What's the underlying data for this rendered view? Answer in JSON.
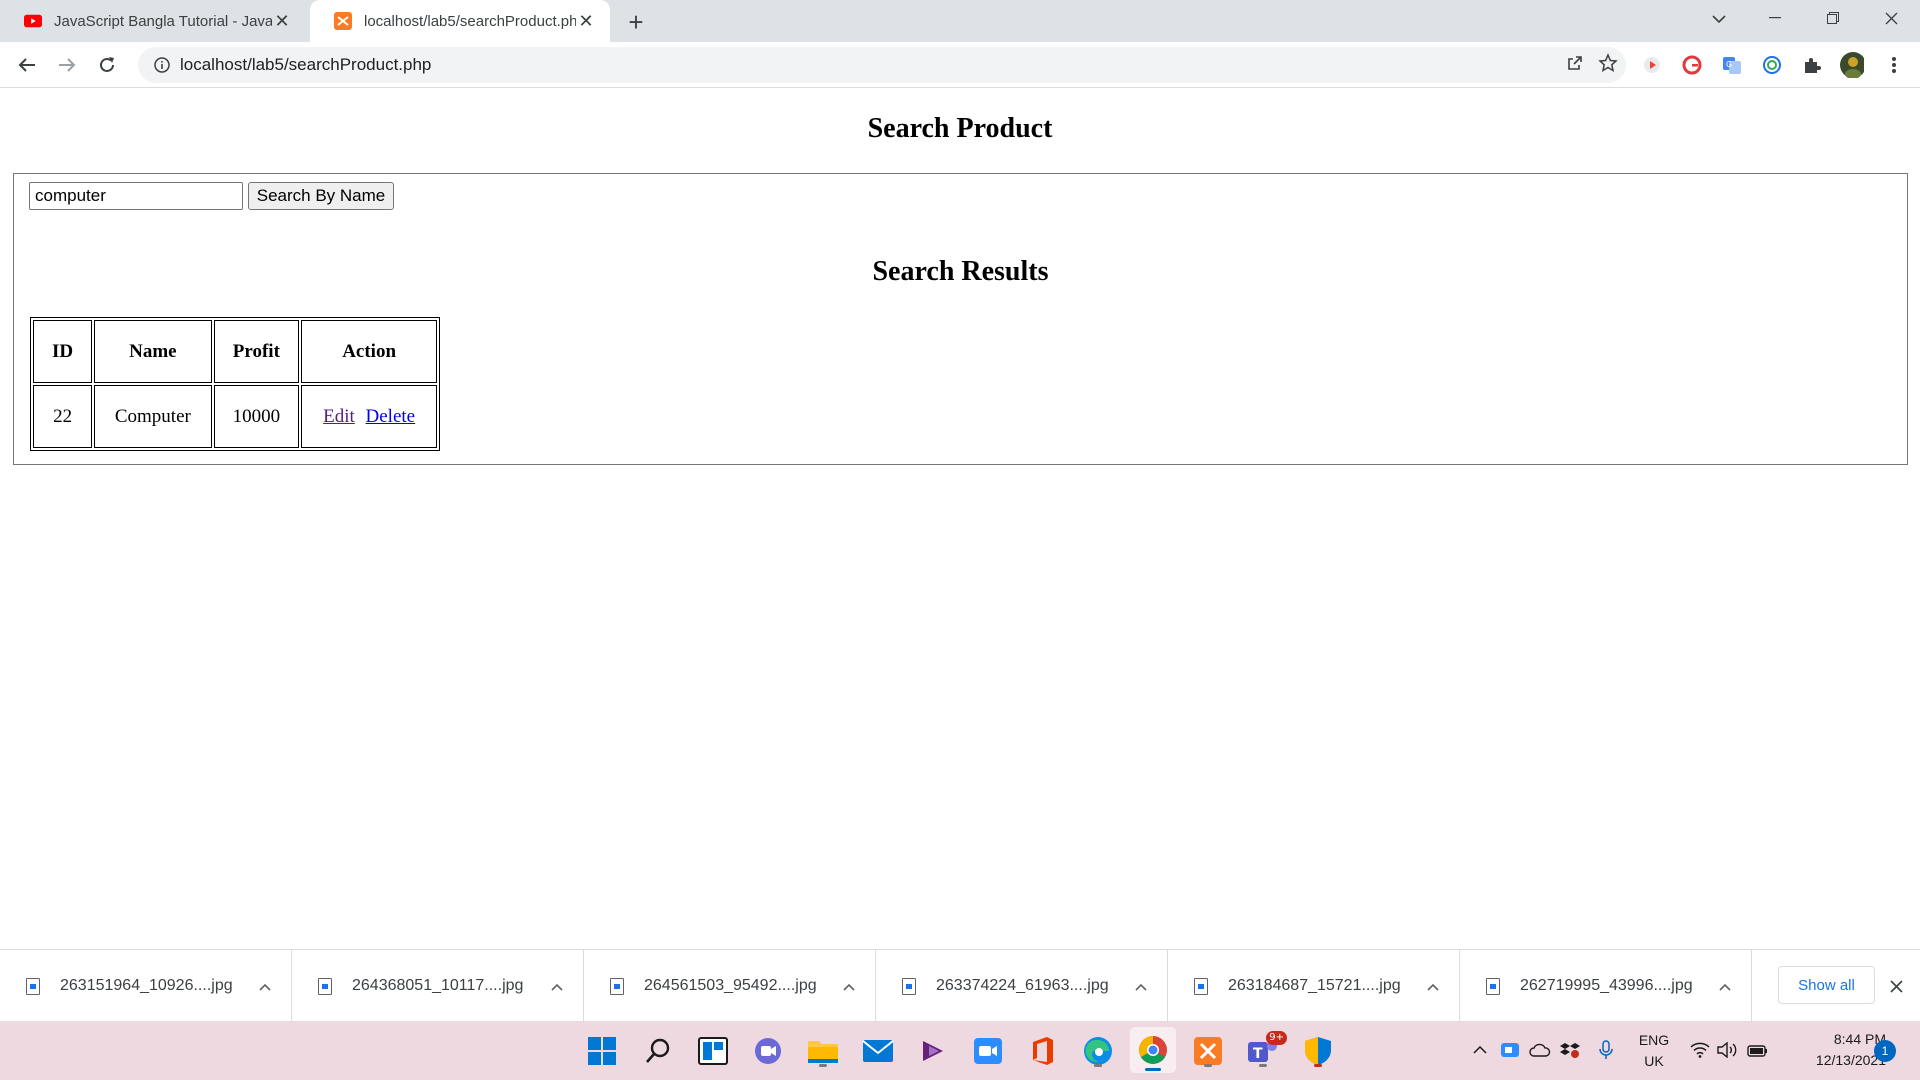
{
  "browser": {
    "tabs": [
      {
        "title": "JavaScript Bangla Tutorial - JavaS",
        "favicon": "youtube-icon",
        "active": false
      },
      {
        "title": "localhost/lab5/searchProduct.php",
        "favicon": "xampp-icon",
        "active": true
      }
    ],
    "url": "localhost/lab5/searchProduct.php"
  },
  "page": {
    "title": "Search Product",
    "search": {
      "value": "computer",
      "button_label": "Search By Name"
    },
    "results_title": "Search Results",
    "table": {
      "headers": [
        "ID",
        "Name",
        "Profit",
        "Action"
      ],
      "rows": [
        {
          "id": "22",
          "name": "Computer",
          "profit": "10000",
          "edit": "Edit",
          "delete": "Delete"
        }
      ]
    }
  },
  "downloads": {
    "items": [
      "263151964_10926....jpg",
      "264368051_10117....jpg",
      "264561503_95492....jpg",
      "263374224_61963....jpg",
      "263184687_15721....jpg",
      "262719995_43996....jpg"
    ],
    "show_all": "Show all"
  },
  "taskbar": {
    "language": "ENG",
    "region": "UK",
    "time": "8:44 PM",
    "date": "12/13/2021",
    "teams_badge": "9+",
    "notification_count": "1"
  },
  "colors": {
    "link": "#0000ee",
    "link_visited": "#551a8b",
    "tabstrip": "#dee1e6",
    "taskbar": "#efd9e0",
    "accent": "#1a73e8"
  }
}
